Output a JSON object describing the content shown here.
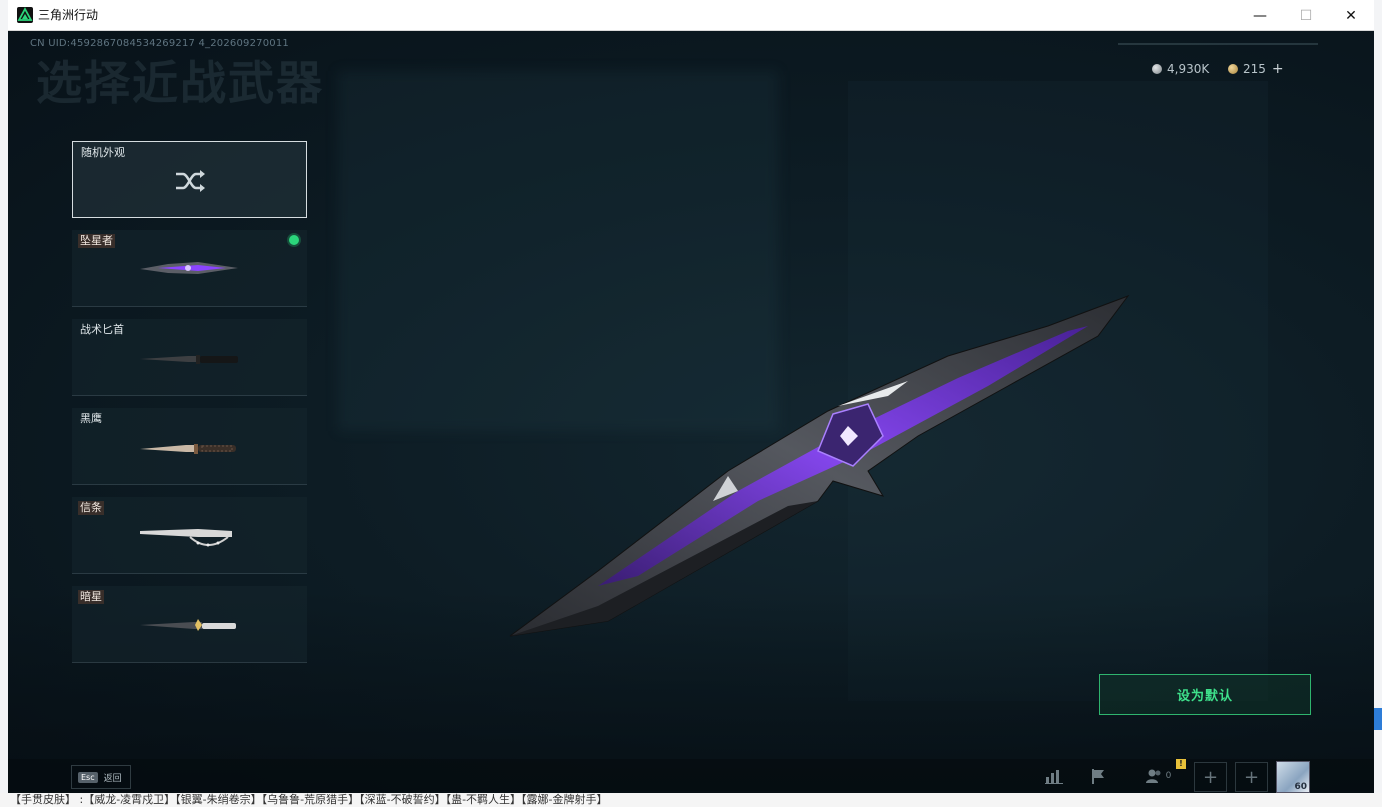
{
  "window": {
    "title": "三角洲行动",
    "minimize": "—",
    "maximize": "☐",
    "close": "✕"
  },
  "header": {
    "uid": "CN UID:4592867084534269217 4_202609270011",
    "page_title": "选择近战武器"
  },
  "currency": {
    "silver_amount": "4,930K",
    "gold_amount": "215",
    "add_symbol": "+"
  },
  "weapons": {
    "random_label": "随机外观",
    "items": [
      {
        "label": "坠星者",
        "equipped": true
      },
      {
        "label": "战术匕首",
        "equipped": false
      },
      {
        "label": "黑鹰",
        "equipped": false
      },
      {
        "label": "信条",
        "equipped": false
      },
      {
        "label": "暗星",
        "equipped": false
      }
    ]
  },
  "actions": {
    "set_default": "设为默认"
  },
  "bottom_bar": {
    "esc_key": "Esc",
    "esc_label": "返回",
    "friends_count": "0",
    "notification_badge": "!",
    "add_symbol": "+",
    "avatar_level": "60"
  },
  "desktop": {
    "taskbar_text": "【手贯皮肤】 :【威龙-凌霄戍卫】【银翼-朱绡卷宗】【乌鲁鲁-荒原猎手】【深蓝-不破誓约】【蛊-不羁人生】【露娜-金牌射手】"
  },
  "colors": {
    "accent_green": "#2fb46e",
    "equipped_dot": "#2bd67b",
    "knife_purple": "#8b45ff"
  }
}
